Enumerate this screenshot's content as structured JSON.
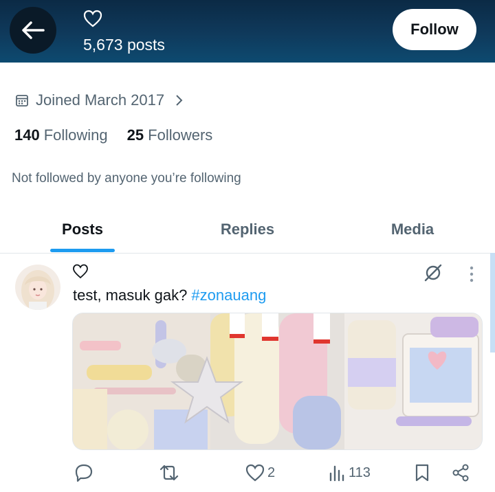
{
  "header": {
    "post_count": "5,673 posts",
    "follow_label": "Follow"
  },
  "profile": {
    "joined": "Joined March 2017",
    "following_count": "140",
    "following_label": "Following",
    "followers_count": "25",
    "followers_label": "Followers",
    "not_followed_text": "Not followed by anyone you’re following"
  },
  "tabs": [
    {
      "label": "Posts",
      "active": true
    },
    {
      "label": "Replies",
      "active": false
    },
    {
      "label": "Media",
      "active": false
    }
  ],
  "post": {
    "text": "test, masuk gak? ",
    "hashtag": "#zonauang",
    "likes": "2",
    "views": "113"
  },
  "colors": {
    "accent": "#1d9bf0",
    "header_bg": "#0f3a5c",
    "muted_text": "#536471"
  },
  "icons": [
    "back-arrow-icon",
    "heart-icon",
    "calendar-icon",
    "chevron-right-icon",
    "grok-icon",
    "more-icon",
    "reply-icon",
    "repost-icon",
    "like-icon",
    "views-icon",
    "bookmark-icon",
    "share-icon"
  ]
}
